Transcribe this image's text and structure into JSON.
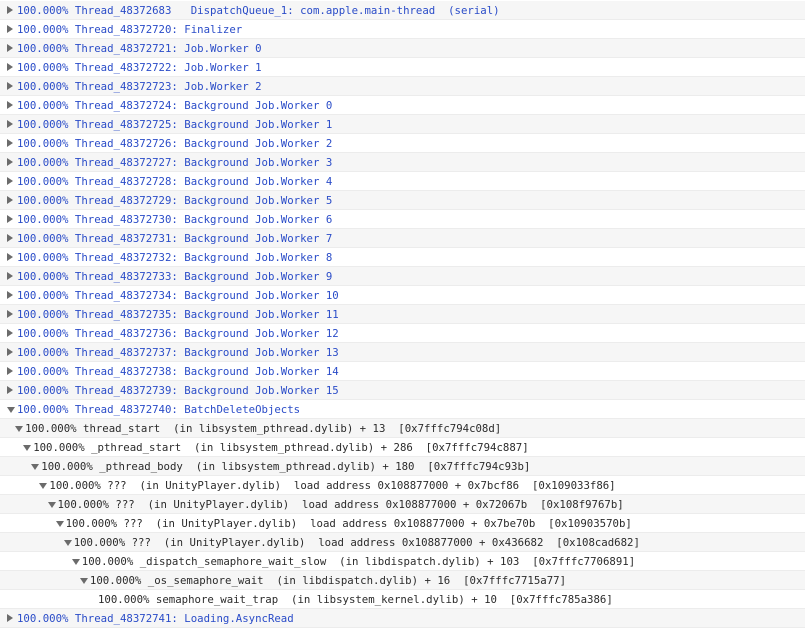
{
  "rows": [
    {
      "text": "100.000% Thread_48372683   DispatchQueue_1: com.apple.main-thread  (serial)",
      "level": 0,
      "toggle": "collapsed",
      "blue": true
    },
    {
      "text": "100.000% Thread_48372720: Finalizer",
      "level": 0,
      "toggle": "collapsed",
      "blue": true
    },
    {
      "text": "100.000% Thread_48372721: Job.Worker 0",
      "level": 0,
      "toggle": "collapsed",
      "blue": true
    },
    {
      "text": "100.000% Thread_48372722: Job.Worker 1",
      "level": 0,
      "toggle": "collapsed",
      "blue": true
    },
    {
      "text": "100.000% Thread_48372723: Job.Worker 2",
      "level": 0,
      "toggle": "collapsed",
      "blue": true
    },
    {
      "text": "100.000% Thread_48372724: Background Job.Worker 0",
      "level": 0,
      "toggle": "collapsed",
      "blue": true
    },
    {
      "text": "100.000% Thread_48372725: Background Job.Worker 1",
      "level": 0,
      "toggle": "collapsed",
      "blue": true
    },
    {
      "text": "100.000% Thread_48372726: Background Job.Worker 2",
      "level": 0,
      "toggle": "collapsed",
      "blue": true
    },
    {
      "text": "100.000% Thread_48372727: Background Job.Worker 3",
      "level": 0,
      "toggle": "collapsed",
      "blue": true
    },
    {
      "text": "100.000% Thread_48372728: Background Job.Worker 4",
      "level": 0,
      "toggle": "collapsed",
      "blue": true
    },
    {
      "text": "100.000% Thread_48372729: Background Job.Worker 5",
      "level": 0,
      "toggle": "collapsed",
      "blue": true
    },
    {
      "text": "100.000% Thread_48372730: Background Job.Worker 6",
      "level": 0,
      "toggle": "collapsed",
      "blue": true
    },
    {
      "text": "100.000% Thread_48372731: Background Job.Worker 7",
      "level": 0,
      "toggle": "collapsed",
      "blue": true
    },
    {
      "text": "100.000% Thread_48372732: Background Job.Worker 8",
      "level": 0,
      "toggle": "collapsed",
      "blue": true
    },
    {
      "text": "100.000% Thread_48372733: Background Job.Worker 9",
      "level": 0,
      "toggle": "collapsed",
      "blue": true
    },
    {
      "text": "100.000% Thread_48372734: Background Job.Worker 10",
      "level": 0,
      "toggle": "collapsed",
      "blue": true
    },
    {
      "text": "100.000% Thread_48372735: Background Job.Worker 11",
      "level": 0,
      "toggle": "collapsed",
      "blue": true
    },
    {
      "text": "100.000% Thread_48372736: Background Job.Worker 12",
      "level": 0,
      "toggle": "collapsed",
      "blue": true
    },
    {
      "text": "100.000% Thread_48372737: Background Job.Worker 13",
      "level": 0,
      "toggle": "collapsed",
      "blue": true
    },
    {
      "text": "100.000% Thread_48372738: Background Job.Worker 14",
      "level": 0,
      "toggle": "collapsed",
      "blue": true
    },
    {
      "text": "100.000% Thread_48372739: Background Job.Worker 15",
      "level": 0,
      "toggle": "collapsed",
      "blue": true
    },
    {
      "text": "100.000% Thread_48372740: BatchDeleteObjects",
      "level": 0,
      "toggle": "expanded",
      "blue": true
    },
    {
      "text": "100.000% thread_start  (in libsystem_pthread.dylib) + 13  [0x7fffc794c08d]",
      "level": 1,
      "toggle": "expanded",
      "blue": false
    },
    {
      "text": "100.000% _pthread_start  (in libsystem_pthread.dylib) + 286  [0x7fffc794c887]",
      "level": 2,
      "toggle": "expanded",
      "blue": false
    },
    {
      "text": "100.000% _pthread_body  (in libsystem_pthread.dylib) + 180  [0x7fffc794c93b]",
      "level": 3,
      "toggle": "expanded",
      "blue": false
    },
    {
      "text": "100.000% ???  (in UnityPlayer.dylib)  load address 0x108877000 + 0x7bcf86  [0x109033f86]",
      "level": 4,
      "toggle": "expanded",
      "blue": false
    },
    {
      "text": "100.000% ???  (in UnityPlayer.dylib)  load address 0x108877000 + 0x72067b  [0x108f9767b]",
      "level": 5,
      "toggle": "expanded",
      "blue": false
    },
    {
      "text": "100.000% ???  (in UnityPlayer.dylib)  load address 0x108877000 + 0x7be70b  [0x10903570b]",
      "level": 6,
      "toggle": "expanded",
      "blue": false
    },
    {
      "text": "100.000% ???  (in UnityPlayer.dylib)  load address 0x108877000 + 0x436682  [0x108cad682]",
      "level": 7,
      "toggle": "expanded",
      "blue": false
    },
    {
      "text": "100.000% _dispatch_semaphore_wait_slow  (in libdispatch.dylib) + 103  [0x7fffc7706891]",
      "level": 8,
      "toggle": "expanded",
      "blue": false
    },
    {
      "text": "100.000% _os_semaphore_wait  (in libdispatch.dylib) + 16  [0x7fffc7715a77]",
      "level": 9,
      "toggle": "expanded",
      "blue": false
    },
    {
      "text": "100.000% semaphore_wait_trap  (in libsystem_kernel.dylib) + 10  [0x7fffc785a386]",
      "level": 10,
      "toggle": "none",
      "blue": false
    },
    {
      "text": "100.000% Thread_48372741: Loading.AsyncRead",
      "level": 0,
      "toggle": "collapsed",
      "blue": true
    }
  ],
  "colors": {
    "thread_link": "#2a4cc8",
    "frame_text": "#2b2b2b",
    "triangle": "#6b6b6b",
    "row_alt": "#f6f6f6"
  }
}
